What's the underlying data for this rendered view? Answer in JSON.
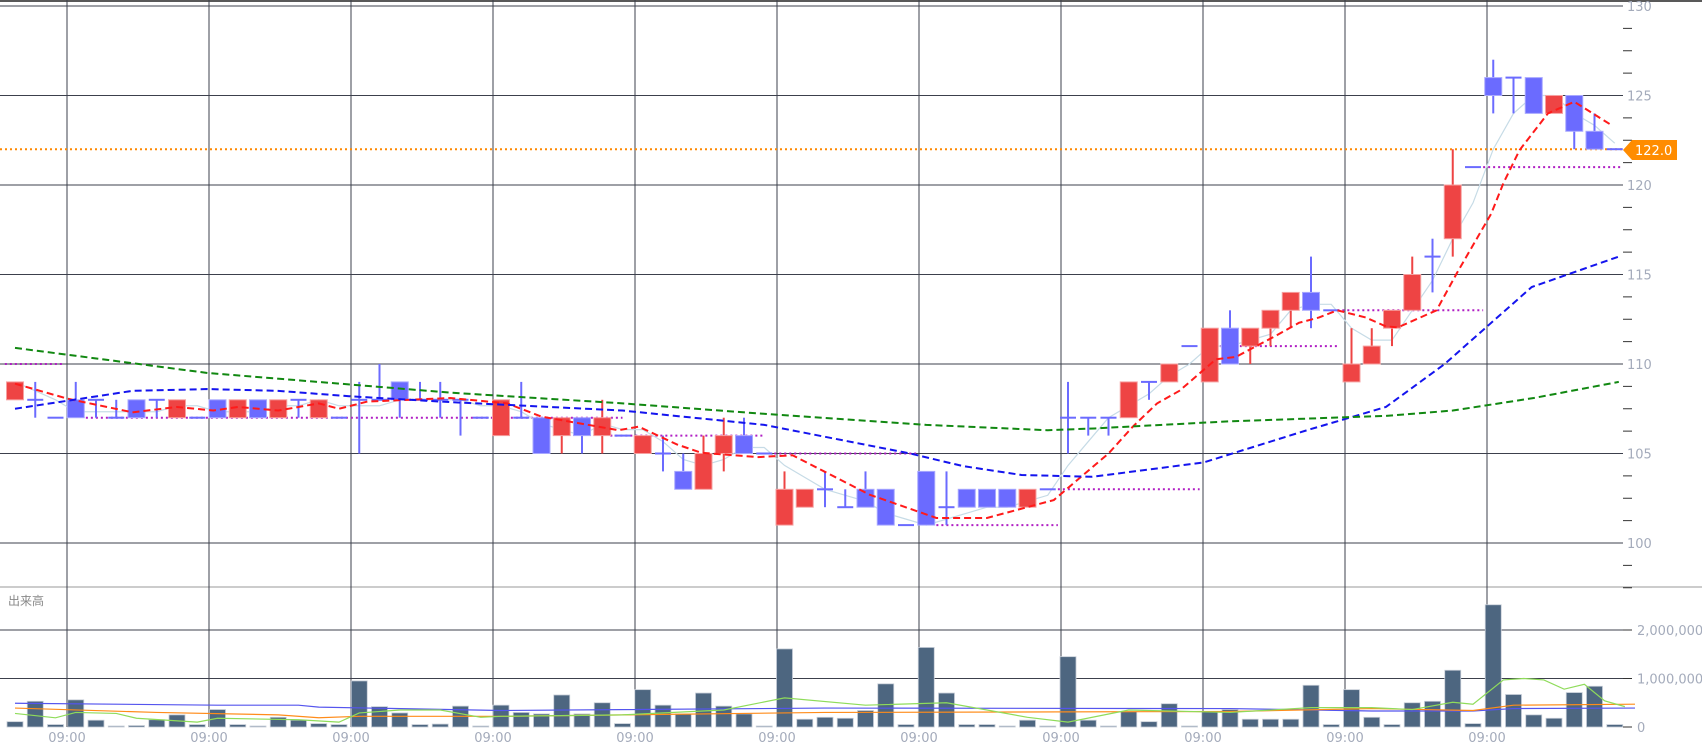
{
  "chart_data": {
    "type": "candlestick",
    "title": "",
    "volume_panel_label": "出来高",
    "current_price": 122.0,
    "current_price_label": "122.0",
    "price_axis": {
      "range": [
        97,
        130
      ],
      "ticks": [
        130,
        125,
        120,
        115,
        110,
        105,
        100
      ],
      "tick_labels": [
        "130",
        "125",
        "120",
        "115",
        "110",
        "105",
        "100"
      ]
    },
    "volume_axis": {
      "range": [
        0,
        2900000
      ],
      "ticks": [
        2000000,
        1000000,
        0
      ],
      "tick_labels": [
        "2,000,000",
        "1,000,000",
        "0"
      ]
    },
    "x_tick_labels": [
      "09:00",
      "09:00",
      "09:00",
      "09:00",
      "09:00",
      "09:00",
      "09:00",
      "09:00",
      "09:00",
      "09:00",
      "09:00"
    ],
    "up_color": "#ee4444",
    "down_color": "#6b6bff",
    "volume_color": "#4d6680",
    "candles_ohlc": [
      [
        108,
        109,
        108,
        109
      ],
      [
        108,
        109,
        107,
        108
      ],
      [
        107,
        107,
        107,
        107
      ],
      [
        108,
        109,
        107,
        107
      ],
      [
        108,
        108,
        107,
        108
      ],
      [
        107,
        108,
        107,
        107
      ],
      [
        108,
        108,
        107,
        107
      ],
      [
        108,
        108,
        107,
        108
      ],
      [
        107,
        108,
        107,
        108
      ],
      [
        107,
        107,
        107,
        107
      ],
      [
        108,
        108,
        107,
        107
      ],
      [
        107,
        108,
        107,
        108
      ],
      [
        108,
        108,
        107,
        107
      ],
      [
        107,
        108,
        107,
        108
      ],
      [
        108,
        108,
        107,
        108
      ],
      [
        107,
        108,
        107,
        108
      ],
      [
        107,
        107,
        107,
        107
      ],
      [
        108,
        109,
        105,
        108
      ],
      [
        108,
        110,
        108,
        108
      ],
      [
        109,
        109,
        107,
        108
      ],
      [
        108,
        109,
        108,
        108
      ],
      [
        108,
        109,
        107,
        108
      ],
      [
        108,
        108,
        106,
        108
      ],
      [
        107,
        107,
        107,
        107
      ],
      [
        106,
        108,
        106,
        108
      ],
      [
        107,
        109,
        107,
        107
      ],
      [
        107,
        107,
        105,
        105
      ],
      [
        106,
        107,
        105,
        107
      ],
      [
        107,
        107,
        105,
        106
      ],
      [
        106,
        108,
        105,
        107
      ],
      [
        106,
        106,
        106,
        106
      ],
      [
        105,
        106,
        105,
        106
      ],
      [
        105,
        106,
        104,
        105
      ],
      [
        104,
        105,
        103,
        103
      ],
      [
        103,
        106,
        103,
        105
      ],
      [
        105,
        107,
        104,
        106
      ],
      [
        106,
        107,
        105,
        105
      ],
      [
        105,
        105,
        105,
        105
      ],
      [
        101,
        104,
        101,
        103
      ],
      [
        102,
        103,
        102,
        103
      ],
      [
        103,
        104,
        102,
        103
      ],
      [
        102,
        103,
        102,
        102
      ],
      [
        103,
        104,
        102,
        102
      ],
      [
        103,
        103,
        101,
        101
      ],
      [
        101,
        101,
        101,
        101
      ],
      [
        104,
        104,
        101,
        101
      ],
      [
        102,
        104,
        101,
        102
      ],
      [
        103,
        103,
        102,
        102
      ],
      [
        103,
        103,
        102,
        102
      ],
      [
        103,
        103,
        102,
        102
      ],
      [
        102,
        103,
        102,
        103
      ],
      [
        103,
        103,
        103,
        103
      ],
      [
        107,
        109,
        105,
        107
      ],
      [
        107,
        107,
        106,
        107
      ],
      [
        107,
        107,
        106,
        107
      ],
      [
        107,
        109,
        107,
        109
      ],
      [
        109,
        109,
        108,
        109
      ],
      [
        109,
        110,
        109,
        110
      ],
      [
        111,
        111,
        111,
        111
      ],
      [
        109,
        112,
        109,
        112
      ],
      [
        112,
        113,
        110,
        110
      ],
      [
        111,
        112,
        110,
        112
      ],
      [
        112,
        113,
        111,
        113
      ],
      [
        113,
        114,
        112,
        114
      ],
      [
        114,
        116,
        112,
        113
      ],
      [
        113,
        113,
        113,
        113
      ],
      [
        109,
        112,
        109,
        110
      ],
      [
        110,
        112,
        110,
        111
      ],
      [
        112,
        113,
        111,
        113
      ],
      [
        113,
        116,
        113,
        115
      ],
      [
        116,
        117,
        114,
        116
      ],
      [
        117,
        122,
        116,
        120
      ],
      [
        121,
        121,
        121,
        121
      ],
      [
        126,
        127,
        124,
        125
      ],
      [
        126,
        126,
        124,
        126
      ],
      [
        126,
        126,
        124,
        124
      ],
      [
        124,
        125,
        124,
        125
      ],
      [
        125,
        125,
        122,
        123
      ],
      [
        123,
        124,
        122,
        122
      ],
      [
        122,
        122,
        122,
        122
      ]
    ],
    "volumes": [
      110000,
      530000,
      50000,
      560000,
      140000,
      20000,
      30000,
      150000,
      250000,
      50000,
      360000,
      50000,
      20000,
      200000,
      140000,
      70000,
      50000,
      950000,
      420000,
      290000,
      50000,
      60000,
      430000,
      20000,
      450000,
      300000,
      270000,
      660000,
      270000,
      500000,
      70000,
      770000,
      450000,
      270000,
      700000,
      430000,
      270000,
      20000,
      1610000,
      160000,
      200000,
      180000,
      340000,
      890000,
      50000,
      1640000,
      700000,
      50000,
      50000,
      20000,
      140000,
      20000,
      1450000,
      140000,
      20000,
      320000,
      110000,
      480000,
      20000,
      320000,
      360000,
      160000,
      160000,
      160000,
      860000,
      50000,
      770000,
      200000,
      50000,
      500000,
      530000,
      1170000,
      70000,
      2520000,
      670000,
      250000,
      180000,
      710000,
      840000,
      50000
    ],
    "price_moving_averages": [
      {
        "name": "ma-short",
        "color": "#ff1a1a",
        "style": "dashed",
        "points": [
          [
            0,
            108.9
          ],
          [
            2.6,
            108.06
          ],
          [
            5.8,
            107.3
          ],
          [
            8,
            107.6
          ],
          [
            9.8,
            107.4
          ],
          [
            11,
            107.6
          ],
          [
            13,
            107.4
          ],
          [
            15,
            107.8
          ],
          [
            16,
            107.5
          ],
          [
            17.4,
            107.9
          ],
          [
            21.5,
            108.1
          ],
          [
            24.3,
            107.8
          ],
          [
            26,
            107.06
          ],
          [
            29.8,
            106.3
          ],
          [
            30.8,
            106.5
          ],
          [
            32.7,
            105.5
          ],
          [
            33.9,
            105.04
          ],
          [
            36.7,
            104.8
          ],
          [
            38.4,
            104.9
          ],
          [
            42.2,
            102.7
          ],
          [
            45.5,
            101.4
          ],
          [
            48,
            101.4
          ],
          [
            51.3,
            102.4
          ],
          [
            54,
            105
          ],
          [
            55.2,
            106.5
          ],
          [
            56.4,
            107.8
          ],
          [
            57.5,
            108.5
          ],
          [
            59.3,
            110.26
          ],
          [
            60.3,
            110.4
          ],
          [
            62.3,
            111.6
          ],
          [
            63.4,
            112.3
          ],
          [
            64.4,
            112.6
          ],
          [
            65.3,
            113
          ],
          [
            66.7,
            112.6
          ],
          [
            67.7,
            112.1
          ],
          [
            68.3,
            112.05
          ],
          [
            70.2,
            113
          ],
          [
            71.2,
            115.07
          ],
          [
            72.9,
            118.4
          ],
          [
            73.5,
            120.1
          ],
          [
            74.3,
            121.95
          ],
          [
            75.7,
            124.0
          ],
          [
            77,
            124.65
          ],
          [
            78.9,
            123.3
          ]
        ]
      },
      {
        "name": "ma-medium",
        "color": "#1414ee",
        "style": "dashed",
        "points": [
          [
            0,
            107.5
          ],
          [
            5.8,
            108.5
          ],
          [
            9.5,
            108.6
          ],
          [
            13,
            108.5
          ],
          [
            16.5,
            108.2
          ],
          [
            21,
            107.9
          ],
          [
            30,
            107.4
          ],
          [
            37,
            106.6
          ],
          [
            44.2,
            105
          ],
          [
            46.8,
            104.3
          ],
          [
            49.7,
            103.8
          ],
          [
            53.2,
            103.7
          ],
          [
            58.7,
            104.5
          ],
          [
            63.8,
            106.3
          ],
          [
            67.7,
            107.6
          ],
          [
            70.6,
            110
          ],
          [
            74.9,
            114.3
          ],
          [
            79.2,
            116
          ]
        ]
      },
      {
        "name": "ma-long",
        "color": "#118811",
        "style": "dashed",
        "points": [
          [
            0,
            110.9
          ],
          [
            9.5,
            109.5
          ],
          [
            21.5,
            108.4
          ],
          [
            30,
            107.8
          ],
          [
            37.2,
            107.2
          ],
          [
            45,
            106.6
          ],
          [
            51,
            106.3
          ],
          [
            53.3,
            106.4
          ],
          [
            60,
            106.8
          ],
          [
            67.7,
            107.1
          ],
          [
            71,
            107.4
          ],
          [
            75,
            108.1
          ],
          [
            79.2,
            109
          ]
        ]
      }
    ],
    "support_resistance_levels": [
      {
        "price": 110,
        "from": -0.5,
        "to": 2.4
      },
      {
        "price": 107,
        "from": 3.5,
        "to": 30
      },
      {
        "price": 106,
        "from": 29.4,
        "to": 37
      },
      {
        "price": 105,
        "from": 37,
        "to": 44.5
      },
      {
        "price": 101,
        "from": 45.5,
        "to": 51.5
      },
      {
        "price": 103,
        "from": 51.5,
        "to": 58.5
      },
      {
        "price": 111,
        "from": 59.5,
        "to": 65.3
      },
      {
        "price": 113,
        "from": 65.3,
        "to": 72.5
      },
      {
        "price": 121,
        "from": 72.5,
        "to": 79.4
      }
    ],
    "volume_moving_averages": [
      {
        "name": "vol-ma-long",
        "color": "#5555ee",
        "points": [
          [
            0,
            490000
          ],
          [
            10,
            450000
          ],
          [
            14,
            450000
          ],
          [
            15,
            410000
          ],
          [
            24,
            340000
          ],
          [
            40,
            390000
          ],
          [
            60,
            380000
          ],
          [
            67,
            330000
          ],
          [
            72,
            330000
          ],
          [
            74,
            380000
          ],
          [
            80,
            390000
          ]
        ]
      },
      {
        "name": "vol-ma-medium",
        "color": "#ff8c1a",
        "points": [
          [
            0,
            390000
          ],
          [
            7,
            300000
          ],
          [
            13,
            250000
          ],
          [
            15,
            190000
          ],
          [
            17,
            220000
          ],
          [
            24,
            220000
          ],
          [
            40,
            300000
          ],
          [
            60,
            320000
          ],
          [
            67,
            380000
          ],
          [
            72,
            340000
          ],
          [
            74,
            450000
          ],
          [
            80,
            470000
          ]
        ]
      },
      {
        "name": "vol-ma-short",
        "color": "#8fdc5a",
        "points": [
          [
            0,
            280000
          ],
          [
            2,
            190000
          ],
          [
            3,
            300000
          ],
          [
            5,
            280000
          ],
          [
            6,
            180000
          ],
          [
            9,
            100000
          ],
          [
            10,
            180000
          ],
          [
            14,
            150000
          ],
          [
            16,
            100000
          ],
          [
            17,
            290000
          ],
          [
            19,
            350000
          ],
          [
            21,
            350000
          ],
          [
            23,
            200000
          ],
          [
            24,
            220000
          ],
          [
            30,
            250000
          ],
          [
            35,
            350000
          ],
          [
            38,
            600000
          ],
          [
            42,
            450000
          ],
          [
            46,
            500000
          ],
          [
            50,
            200000
          ],
          [
            52,
            100000
          ],
          [
            55,
            350000
          ],
          [
            60,
            300000
          ],
          [
            64,
            400000
          ],
          [
            67,
            400000
          ],
          [
            69,
            360000
          ],
          [
            71,
            510000
          ],
          [
            72,
            470000
          ],
          [
            73.5,
            970000
          ],
          [
            74.5,
            1000000
          ],
          [
            75.5,
            970000
          ],
          [
            76.5,
            780000
          ],
          [
            77.5,
            880000
          ],
          [
            78.5,
            540000
          ],
          [
            79.5,
            420000
          ]
        ]
      }
    ]
  }
}
